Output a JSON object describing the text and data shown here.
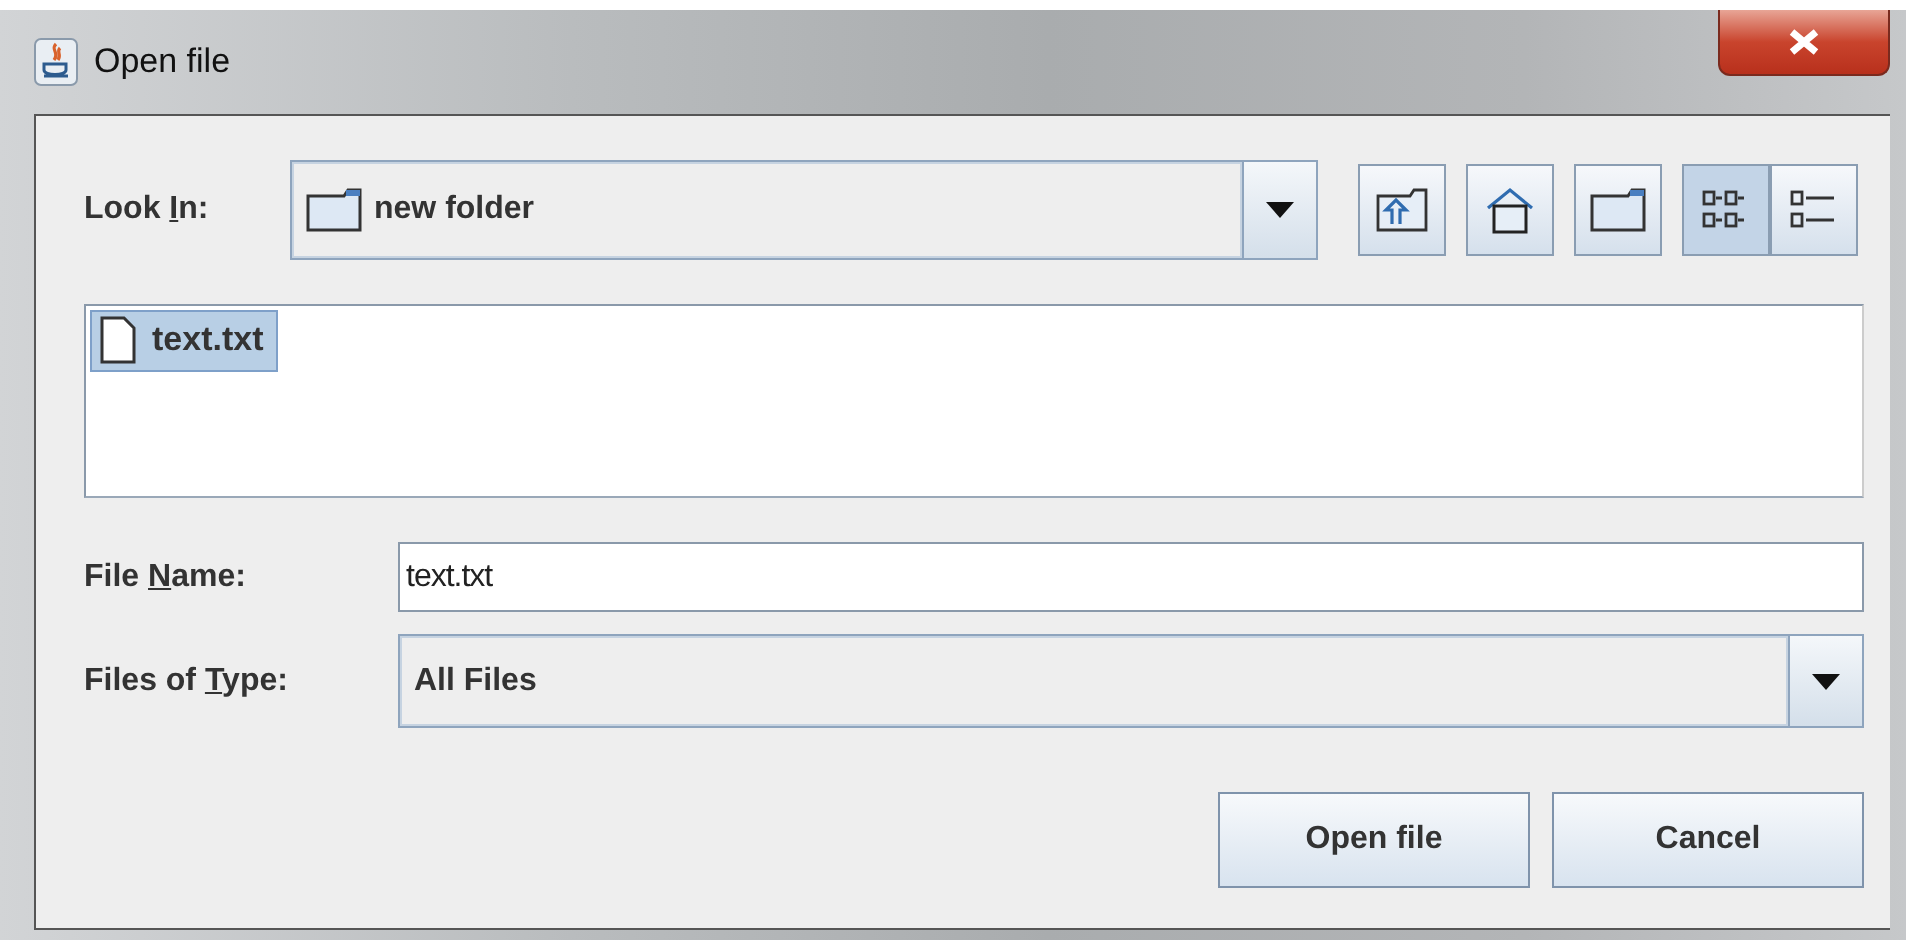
{
  "window": {
    "title": "Open file"
  },
  "look_in": {
    "label": {
      "before": "Look ",
      "mnemonic": "I",
      "after": "n:"
    },
    "value": "new folder"
  },
  "toolbar": [
    {
      "kind": "up-folder",
      "selected": false
    },
    {
      "kind": "home",
      "selected": false
    },
    {
      "kind": "new-folder",
      "selected": false
    },
    {
      "kind": "list-view",
      "selected": true
    },
    {
      "kind": "details-view",
      "selected": false
    }
  ],
  "files": [
    {
      "name": "text.txt",
      "selected": true
    }
  ],
  "file_name": {
    "label": {
      "before": "File ",
      "mnemonic": "N",
      "after": "ame:"
    },
    "value": "text.txt"
  },
  "files_of_type": {
    "label": {
      "before": "Files of ",
      "mnemonic": "T",
      "after": "ype:"
    },
    "value": "All Files"
  },
  "buttons": [
    {
      "label": "Open file"
    },
    {
      "label": "Cancel"
    }
  ]
}
